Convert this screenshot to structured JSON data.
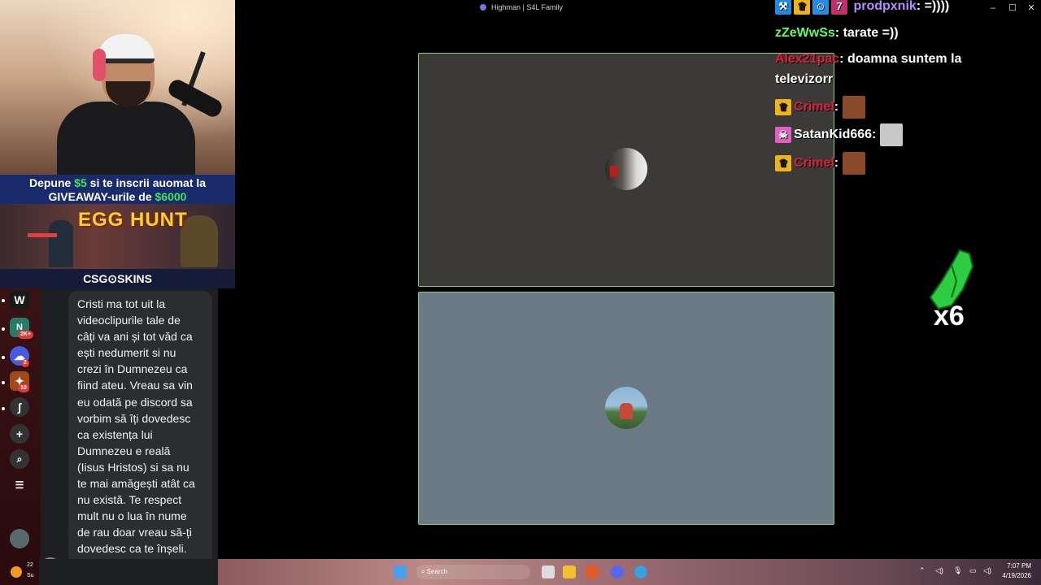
{
  "window": {
    "title": "Highman | S4L Family",
    "minimize": "–",
    "maximize": "☐",
    "close": "✕"
  },
  "promo": {
    "line1_a": "Depune ",
    "line1_amount": "$5",
    "line1_b": " si te inscrii auomat la",
    "line2_a": "GIVEAWAY-urile de ",
    "line2_amount": "$6000",
    "event_title": "EGG HUNT",
    "sponsor": "CSG⊙SKINS"
  },
  "sidebar": {
    "items": [
      {
        "label": "W"
      },
      {
        "label": "N",
        "badge": "2K+"
      },
      {
        "label": "☁",
        "badge": "2"
      },
      {
        "label": "✦",
        "badge": "10"
      },
      {
        "label": "ʃ"
      },
      {
        "label": "+"
      },
      {
        "label": "⌕"
      }
    ]
  },
  "message": {
    "text": "Cristi ma tot uit la\nvideoclipurile tale de\ncâți va ani și tot văd ca\nești nedumerit si nu\ncrezi în Dumnezeu ca\nfiind ateu. Vreau sa vin\neu odată pe discord sa\nvorbim să îți dovedesc\nca existența lui\nDumnezeu e reală\n(Iisus Hristos) si sa nu\nte mai amăgești atât ca\nnu există. Te respect\nmult nu o lua în nume\nde rau doar vreau să-ți\ndovedesc ca te înșeli.\nLove you 🫶"
  },
  "chat": {
    "messages": [
      {
        "user": "prodpxnik",
        "text": "=))))",
        "user_color": "#b78cff"
      },
      {
        "user": "zZeWwSs",
        "text": "tarate =))",
        "user_color": "#5fff5f"
      },
      {
        "user": "Alex21pac",
        "text": "doamna suntem la",
        "text2": "televizorr",
        "user_color": "#e0203a"
      },
      {
        "user": "Crimel",
        "text": "",
        "user_color": "#e0203a"
      },
      {
        "user": "SatanKid666",
        "text": "",
        "user_color": "#ffffff"
      },
      {
        "user": "Crimel",
        "text": "",
        "user_color": "#e0203a"
      }
    ]
  },
  "hype": {
    "count": "x6"
  },
  "taskbar": {
    "weather_temp": "22",
    "weather_label": "Su",
    "search_placeholder": "Search",
    "time": "7:07 PM",
    "date": "4/19/2026"
  },
  "colors": {
    "tile_border": "#7ecf78",
    "tile1_bg": "#3c3a38",
    "tile2_bg": "#6b7a84",
    "promo_green": "#45e05a"
  }
}
